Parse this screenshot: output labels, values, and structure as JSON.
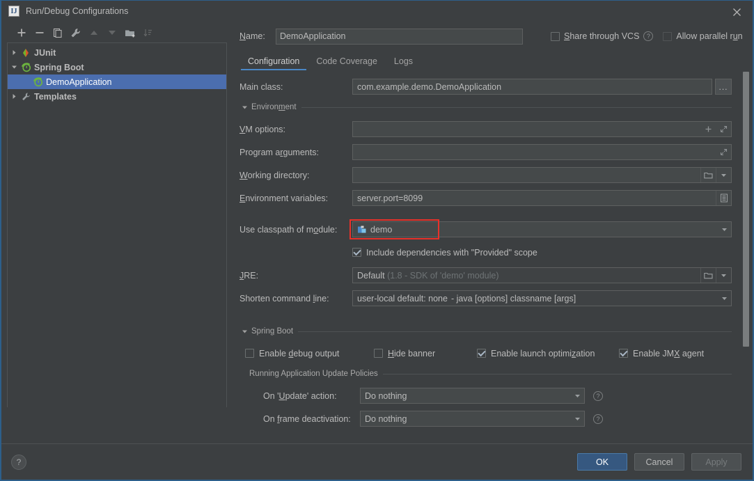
{
  "window": {
    "title": "Run/Debug Configurations",
    "app_icon": "IJ",
    "close_icon": "close-icon",
    "accent": "#4b6eaf",
    "primary_button_color": "#365880",
    "highlight_color": "#e8312a",
    "background": "#3c3f41"
  },
  "tree_toolbar": [
    {
      "name": "add-button",
      "icon": "plus-icon",
      "enabled": true
    },
    {
      "name": "remove-button",
      "icon": "minus-icon",
      "enabled": true
    },
    {
      "name": "copy-button",
      "icon": "copy-icon",
      "enabled": true
    },
    {
      "name": "edit-templates-button",
      "icon": "wrench-icon",
      "enabled": true
    },
    {
      "name": "move-up-button",
      "icon": "arrow-up-icon",
      "enabled": false
    },
    {
      "name": "move-down-button",
      "icon": "arrow-down-icon",
      "enabled": false
    },
    {
      "name": "new-folder-button",
      "icon": "folder-add-icon",
      "enabled": true
    },
    {
      "name": "sort-button",
      "icon": "sort-icon",
      "enabled": false
    }
  ],
  "tree": {
    "items": [
      {
        "label": "JUnit",
        "icon": "junit-icon",
        "level": 0,
        "expanded": false,
        "bold": true,
        "selected": false
      },
      {
        "label": "Spring Boot",
        "icon": "spring-boot-icon",
        "level": 0,
        "expanded": true,
        "bold": true,
        "selected": false
      },
      {
        "label": "DemoApplication",
        "icon": "spring-boot-icon",
        "level": 1,
        "expanded": null,
        "bold": false,
        "selected": true
      },
      {
        "label": "Templates",
        "icon": "wrench-icon",
        "level": 0,
        "expanded": false,
        "bold": true,
        "selected": false
      }
    ]
  },
  "name_row": {
    "label": "Name:",
    "label_mnemonic": "N",
    "value": "DemoApplication",
    "share_vcs": {
      "label": "Share through VCS",
      "mnemonic": "S",
      "checked": false
    },
    "share_vcs_help": "?",
    "allow_parallel": {
      "label": "Allow parallel run",
      "mnemonic": "u",
      "checked": false
    }
  },
  "tabs": [
    {
      "label": "Configuration",
      "active": true
    },
    {
      "label": "Code Coverage",
      "active": false
    },
    {
      "label": "Logs",
      "active": false
    }
  ],
  "form": {
    "main_class": {
      "label": "Main class:",
      "value": "com.example.demo.DemoApplication",
      "browse_label": "..."
    },
    "environment_section": {
      "label": "Environment",
      "mnemonic": "m",
      "expanded": true
    },
    "vm_options": {
      "label": "VM options:",
      "mnemonic": "V",
      "value": "",
      "buttons": [
        "plus-icon",
        "expand-icon"
      ]
    },
    "program_arguments": {
      "label": "Program arguments:",
      "mnemonic": "r",
      "value": "",
      "buttons": [
        "expand-icon"
      ]
    },
    "working_directory": {
      "label": "Working directory:",
      "mnemonic": "W",
      "value": "",
      "buttons": [
        "folder-icon",
        "chevron-down-icon"
      ]
    },
    "environment_variables": {
      "label": "Environment variables:",
      "mnemonic": "E",
      "value": "server.port=8099",
      "buttons": [
        "list-editor-icon"
      ],
      "highlighted": true
    },
    "use_classpath_of_module": {
      "label": "Use classpath of module:",
      "mnemonic": "o",
      "value": "demo",
      "value_icon": "module-icon"
    },
    "include_provided": {
      "label": "Include dependencies with \"Provided\" scope",
      "mnemonic": "d",
      "checked": true
    },
    "jre": {
      "label": "JRE:",
      "mnemonic": "J",
      "value": "Default",
      "value_hint": "(1.8 - SDK of 'demo' module)",
      "buttons": [
        "folder-icon",
        "chevron-down-icon"
      ]
    },
    "shorten_command_line": {
      "label": "Shorten command line:",
      "mnemonic": "l",
      "value": "user-local default: none",
      "value_hint": "- java [options] classname [args]"
    },
    "spring_boot_section": {
      "label": "Spring Boot",
      "mnemonic": "g",
      "expanded": true
    },
    "spring_checkboxes": [
      {
        "label": "Enable debug output",
        "mnemonic": "d",
        "checked": false
      },
      {
        "label": "Hide banner",
        "mnemonic": "H",
        "checked": false
      },
      {
        "label": "Enable launch optimization",
        "mnemonic": "z",
        "checked": true
      },
      {
        "label": "Enable JMX agent",
        "mnemonic": "X",
        "checked": true
      }
    ],
    "update_policies_section": {
      "label": "Running Application Update Policies"
    },
    "on_update_action": {
      "label": "On 'Update' action:",
      "mnemonic": "U",
      "value": "Do nothing",
      "help": "?"
    },
    "on_frame_deactivation": {
      "label": "On frame deactivation:",
      "mnemonic": "f",
      "value": "Do nothing",
      "help": "?"
    }
  },
  "footer": {
    "help_icon": "?",
    "buttons": [
      {
        "label": "OK",
        "style": "primary",
        "enabled": true
      },
      {
        "label": "Cancel",
        "style": "normal",
        "enabled": true
      },
      {
        "label": "Apply",
        "style": "normal",
        "enabled": false
      }
    ]
  }
}
